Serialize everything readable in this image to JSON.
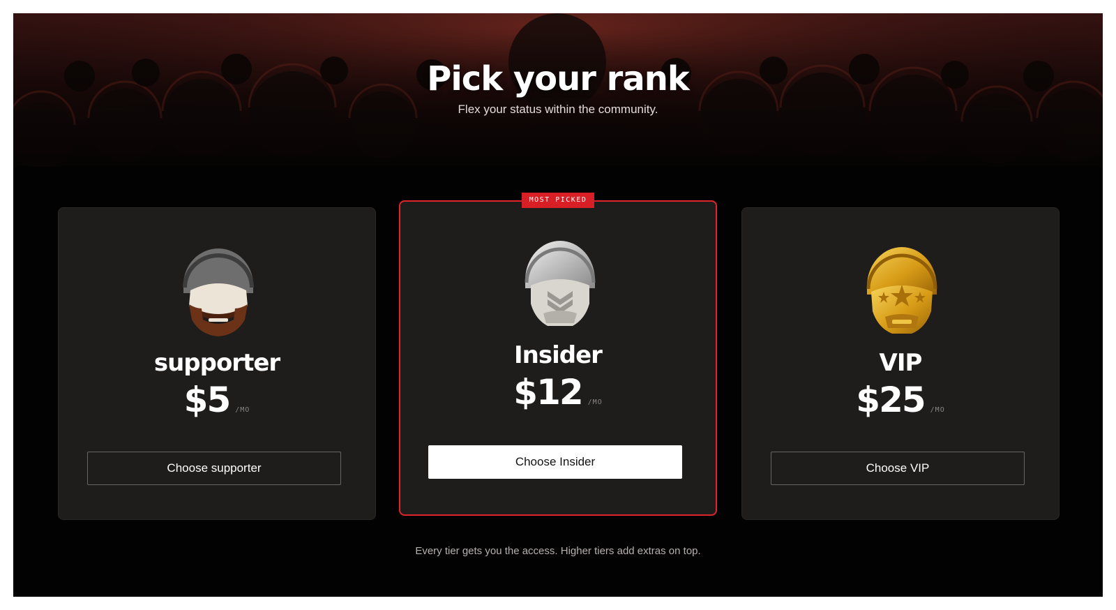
{
  "hero": {
    "title": "Pick your rank",
    "subtitle": "Flex your status within the community."
  },
  "tiers": [
    {
      "name": "supporter",
      "price": "$5",
      "period": "/MO",
      "cta": "Choose supporter",
      "icon": "bearded-helmet-avatar-icon",
      "accent": "#6e6e6e"
    },
    {
      "name": "Insider",
      "price": "$12",
      "period": "/MO",
      "cta": "Choose Insider",
      "badge": "MOST PICKED",
      "icon": "silver-chevron-helmet-avatar-icon",
      "accent": "#d8d8d8"
    },
    {
      "name": "VIP",
      "price": "$25",
      "period": "/MO",
      "cta": "Choose VIP",
      "icon": "gold-star-helmet-avatar-icon",
      "accent": "#d9a21c"
    }
  ],
  "footer": {
    "note": "Every tier gets you the access. Higher tiers add extras on top."
  },
  "colors": {
    "background": "#020202",
    "card": "#1f1c1c",
    "featured_border": "#e0242b",
    "badge": "#d81f26"
  }
}
